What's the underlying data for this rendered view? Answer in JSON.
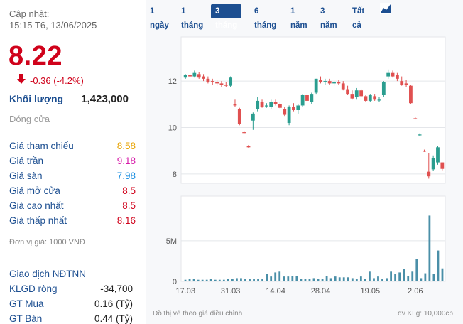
{
  "header": {
    "updated_label": "Cập nhật:",
    "updated_time": "15:15 T6, 13/06/2025"
  },
  "price": {
    "current": "8.22",
    "change": "-0.36 (-4.2%)",
    "color": "#d0021b"
  },
  "volume": {
    "label": "Khối lượng",
    "value": "1,423,000"
  },
  "status": "Đóng cửa",
  "stats": [
    {
      "label": "Giá tham chiếu",
      "value": "8.58",
      "color": "#e8a300"
    },
    {
      "label": "Giá trần",
      "value": "9.18",
      "color": "#d61aa8"
    },
    {
      "label": "Giá sàn",
      "value": "7.98",
      "color": "#1d8fe0"
    },
    {
      "label": "Giá mở cửa",
      "value": "8.5",
      "color": "#d0021b"
    },
    {
      "label": "Giá cao nhất",
      "value": "8.5",
      "color": "#d0021b"
    },
    {
      "label": "Giá thấp nhất",
      "value": "8.16",
      "color": "#d0021b"
    }
  ],
  "unit_note": "Đơn vị giá: 1000 VNĐ",
  "foreign": {
    "title": "Giao dịch NĐTNN",
    "rows": [
      {
        "label": "KLGD ròng",
        "value": "-34,700"
      },
      {
        "label": "GT Mua",
        "value": "0.16 (Tỷ)"
      },
      {
        "label": "GT Bán",
        "value": "0.44 (Tỷ)"
      }
    ]
  },
  "tabs": [
    "1 ngày",
    "1 tháng",
    "3 tháng",
    "6 tháng",
    "1 năm",
    "3 năm",
    "Tất cả"
  ],
  "active_tab": "3 tháng",
  "footer": {
    "left": "Đồ thị vẽ theo giá điều chỉnh",
    "right": "đv KLg: 10,000cp"
  },
  "colors": {
    "up": "#2a9d8f",
    "down": "#e05050",
    "volume": "#4a8fa8",
    "accent": "#1d4f91"
  },
  "chart_data": {
    "type": "candlestick",
    "price_ticks": [
      "12",
      "10",
      "8"
    ],
    "price_ylim": [
      7.6,
      13.9
    ],
    "volume_ticks": [
      "5M",
      "0"
    ],
    "volume_ylim": [
      0,
      10.5
    ],
    "date_labels": [
      {
        "label": "17.03",
        "index": 0
      },
      {
        "label": "31.03",
        "index": 10
      },
      {
        "label": "14.04",
        "index": 20
      },
      {
        "label": "28.04",
        "index": 30
      },
      {
        "label": "19.05",
        "index": 41
      },
      {
        "label": "2.06",
        "index": 51
      }
    ],
    "candles": [
      {
        "o": 12.15,
        "h": 12.3,
        "l": 12.1,
        "c": 12.25
      },
      {
        "o": 12.25,
        "h": 12.35,
        "l": 12.15,
        "c": 12.2
      },
      {
        "o": 12.2,
        "h": 12.45,
        "l": 12.15,
        "c": 12.35
      },
      {
        "o": 12.3,
        "h": 12.4,
        "l": 12.1,
        "c": 12.15
      },
      {
        "o": 12.2,
        "h": 12.3,
        "l": 12.0,
        "c": 12.1
      },
      {
        "o": 12.1,
        "h": 12.2,
        "l": 11.9,
        "c": 11.95
      },
      {
        "o": 12.0,
        "h": 12.1,
        "l": 11.85,
        "c": 11.95
      },
      {
        "o": 11.95,
        "h": 12.05,
        "l": 11.8,
        "c": 11.9
      },
      {
        "o": 11.9,
        "h": 12.0,
        "l": 11.75,
        "c": 11.85
      },
      {
        "o": 11.85,
        "h": 11.95,
        "l": 11.75,
        "c": 11.8
      },
      {
        "o": 11.8,
        "h": 12.2,
        "l": 11.75,
        "c": 12.15
      },
      {
        "o": 11.0,
        "h": 11.2,
        "l": 10.9,
        "c": 10.95
      },
      {
        "o": 10.8,
        "h": 10.85,
        "l": 10.1,
        "c": 10.15
      },
      {
        "o": 9.8,
        "h": 9.85,
        "l": 9.75,
        "c": 9.78
      },
      {
        "o": 9.2,
        "h": 9.25,
        "l": 9.1,
        "c": 9.15
      },
      {
        "o": 10.3,
        "h": 10.65,
        "l": 9.9,
        "c": 10.6
      },
      {
        "o": 10.8,
        "h": 11.3,
        "l": 10.7,
        "c": 11.15
      },
      {
        "o": 11.1,
        "h": 11.2,
        "l": 10.85,
        "c": 10.9
      },
      {
        "o": 10.95,
        "h": 11.05,
        "l": 10.85,
        "c": 10.95
      },
      {
        "o": 10.9,
        "h": 11.2,
        "l": 10.8,
        "c": 11.1
      },
      {
        "o": 11.1,
        "h": 11.2,
        "l": 10.95,
        "c": 11.0
      },
      {
        "o": 11.0,
        "h": 11.1,
        "l": 10.8,
        "c": 10.85
      },
      {
        "o": 10.8,
        "h": 10.9,
        "l": 10.5,
        "c": 10.55
      },
      {
        "o": 10.2,
        "h": 10.95,
        "l": 10.1,
        "c": 10.9
      },
      {
        "o": 10.9,
        "h": 11.05,
        "l": 10.7,
        "c": 10.75
      },
      {
        "o": 10.75,
        "h": 11.0,
        "l": 10.6,
        "c": 10.95
      },
      {
        "o": 10.95,
        "h": 11.45,
        "l": 10.9,
        "c": 11.4
      },
      {
        "o": 11.4,
        "h": 11.5,
        "l": 11.1,
        "c": 11.15
      },
      {
        "o": 11.1,
        "h": 11.5,
        "l": 11.0,
        "c": 11.45
      },
      {
        "o": 11.5,
        "h": 12.1,
        "l": 11.45,
        "c": 12.1
      },
      {
        "o": 12.05,
        "h": 12.2,
        "l": 11.9,
        "c": 11.95
      },
      {
        "o": 11.95,
        "h": 12.1,
        "l": 11.85,
        "c": 12.0
      },
      {
        "o": 12.0,
        "h": 12.1,
        "l": 11.85,
        "c": 11.9
      },
      {
        "o": 11.9,
        "h": 12.0,
        "l": 11.8,
        "c": 11.95
      },
      {
        "o": 11.95,
        "h": 12.05,
        "l": 11.85,
        "c": 11.9
      },
      {
        "o": 11.9,
        "h": 12.0,
        "l": 11.6,
        "c": 11.65
      },
      {
        "o": 11.65,
        "h": 11.8,
        "l": 11.4,
        "c": 11.45
      },
      {
        "o": 11.45,
        "h": 11.6,
        "l": 11.2,
        "c": 11.25
      },
      {
        "o": 11.3,
        "h": 11.7,
        "l": 11.2,
        "c": 11.6
      },
      {
        "o": 11.6,
        "h": 11.65,
        "l": 11.3,
        "c": 11.35
      },
      {
        "o": 11.35,
        "h": 11.4,
        "l": 11.1,
        "c": 11.15
      },
      {
        "o": 11.15,
        "h": 11.45,
        "l": 11.1,
        "c": 11.4
      },
      {
        "o": 11.35,
        "h": 11.45,
        "l": 11.15,
        "c": 11.2
      },
      {
        "o": 11.2,
        "h": 11.3,
        "l": 11.1,
        "c": 11.2
      },
      {
        "o": 11.4,
        "h": 12.0,
        "l": 11.3,
        "c": 11.95
      },
      {
        "o": 12.2,
        "h": 12.5,
        "l": 12.1,
        "c": 12.35
      },
      {
        "o": 12.35,
        "h": 12.45,
        "l": 12.15,
        "c": 12.2
      },
      {
        "o": 12.25,
        "h": 12.35,
        "l": 12.0,
        "c": 12.1
      },
      {
        "o": 12.0,
        "h": 12.2,
        "l": 11.8,
        "c": 11.85
      },
      {
        "o": 11.9,
        "h": 12.05,
        "l": 11.75,
        "c": 11.85
      },
      {
        "o": 11.8,
        "h": 11.85,
        "l": 11.0,
        "c": 11.05
      },
      {
        "o": 10.4,
        "h": 10.45,
        "l": 10.35,
        "c": 10.38
      },
      {
        "o": 9.7,
        "h": 9.75,
        "l": 9.65,
        "c": 9.7
      },
      {
        "o": 9.0,
        "h": 9.05,
        "l": 8.95,
        "c": 8.98
      },
      {
        "o": 8.1,
        "h": 8.9,
        "l": 7.8,
        "c": 7.9
      },
      {
        "o": 8.2,
        "h": 8.8,
        "l": 8.15,
        "c": 8.7
      },
      {
        "o": 8.5,
        "h": 9.2,
        "l": 8.4,
        "c": 9.15
      },
      {
        "o": 8.5,
        "h": 8.5,
        "l": 8.16,
        "c": 8.22
      }
    ],
    "volumes": [
      0.2,
      0.3,
      0.3,
      0.2,
      0.2,
      0.2,
      0.3,
      0.2,
      0.2,
      0.2,
      0.3,
      0.3,
      0.4,
      0.4,
      0.3,
      0.3,
      0.3,
      0.3,
      0.3,
      0.9,
      0.6,
      1.1,
      1.2,
      0.6,
      0.6,
      0.7,
      0.7,
      0.3,
      0.3,
      0.3,
      0.4,
      0.3,
      0.3,
      0.7,
      0.4,
      0.6,
      0.5,
      0.5,
      0.5,
      0.4,
      0.3,
      0.6,
      0.3,
      1.2,
      0.4,
      0.6,
      0.3,
      0.4,
      1.2,
      0.9,
      1.1,
      1.5,
      0.7,
      1.2,
      2.8,
      0.4,
      1.0,
      8.1,
      0.9,
      3.8,
      1.6
    ]
  }
}
